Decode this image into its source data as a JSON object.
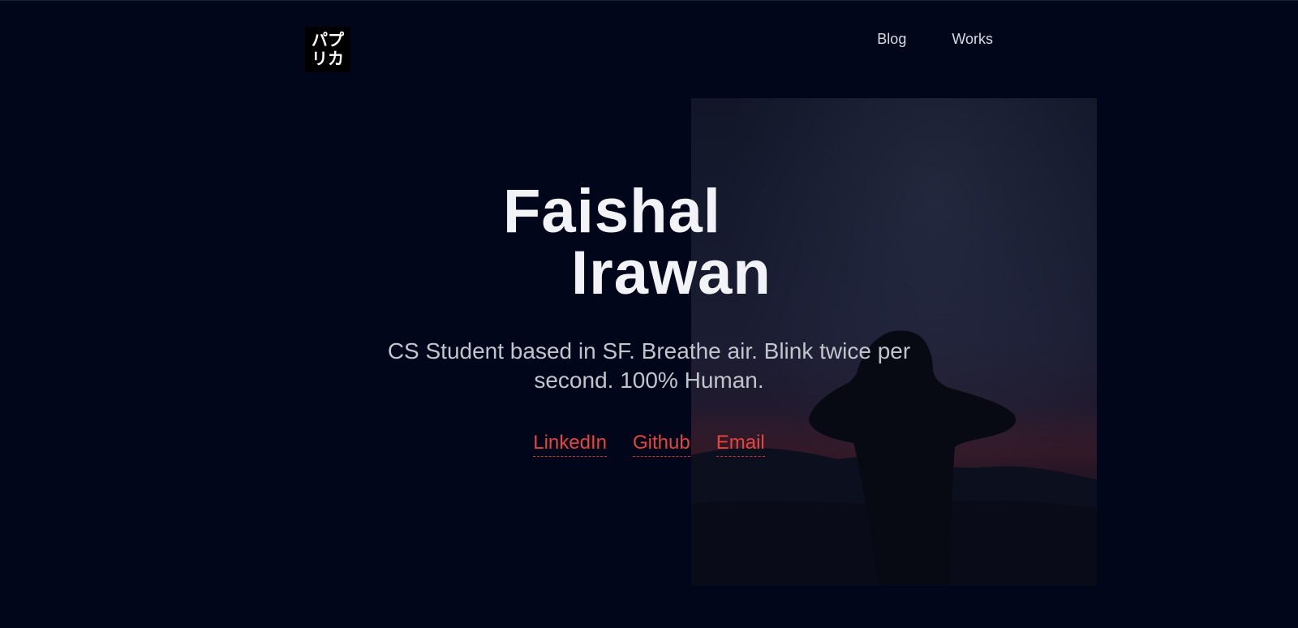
{
  "header": {
    "logo": {
      "line1": "パプ",
      "line2": "リカ"
    },
    "nav": [
      {
        "label": "Blog"
      },
      {
        "label": "Works"
      }
    ]
  },
  "hero": {
    "first_name": "Faishal",
    "last_name": "Irawan",
    "bio": "CS Student based in SF. Breathe air. Blink twice per second. 100% Human.",
    "links": [
      {
        "label": "LinkedIn"
      },
      {
        "label": "Github"
      },
      {
        "label": "Email"
      }
    ]
  },
  "colors": {
    "background": "#02061a",
    "text": "#f2f3f7",
    "muted": "#c2c4cc",
    "accent": "#e5453d",
    "logo_bg": "#000000"
  }
}
